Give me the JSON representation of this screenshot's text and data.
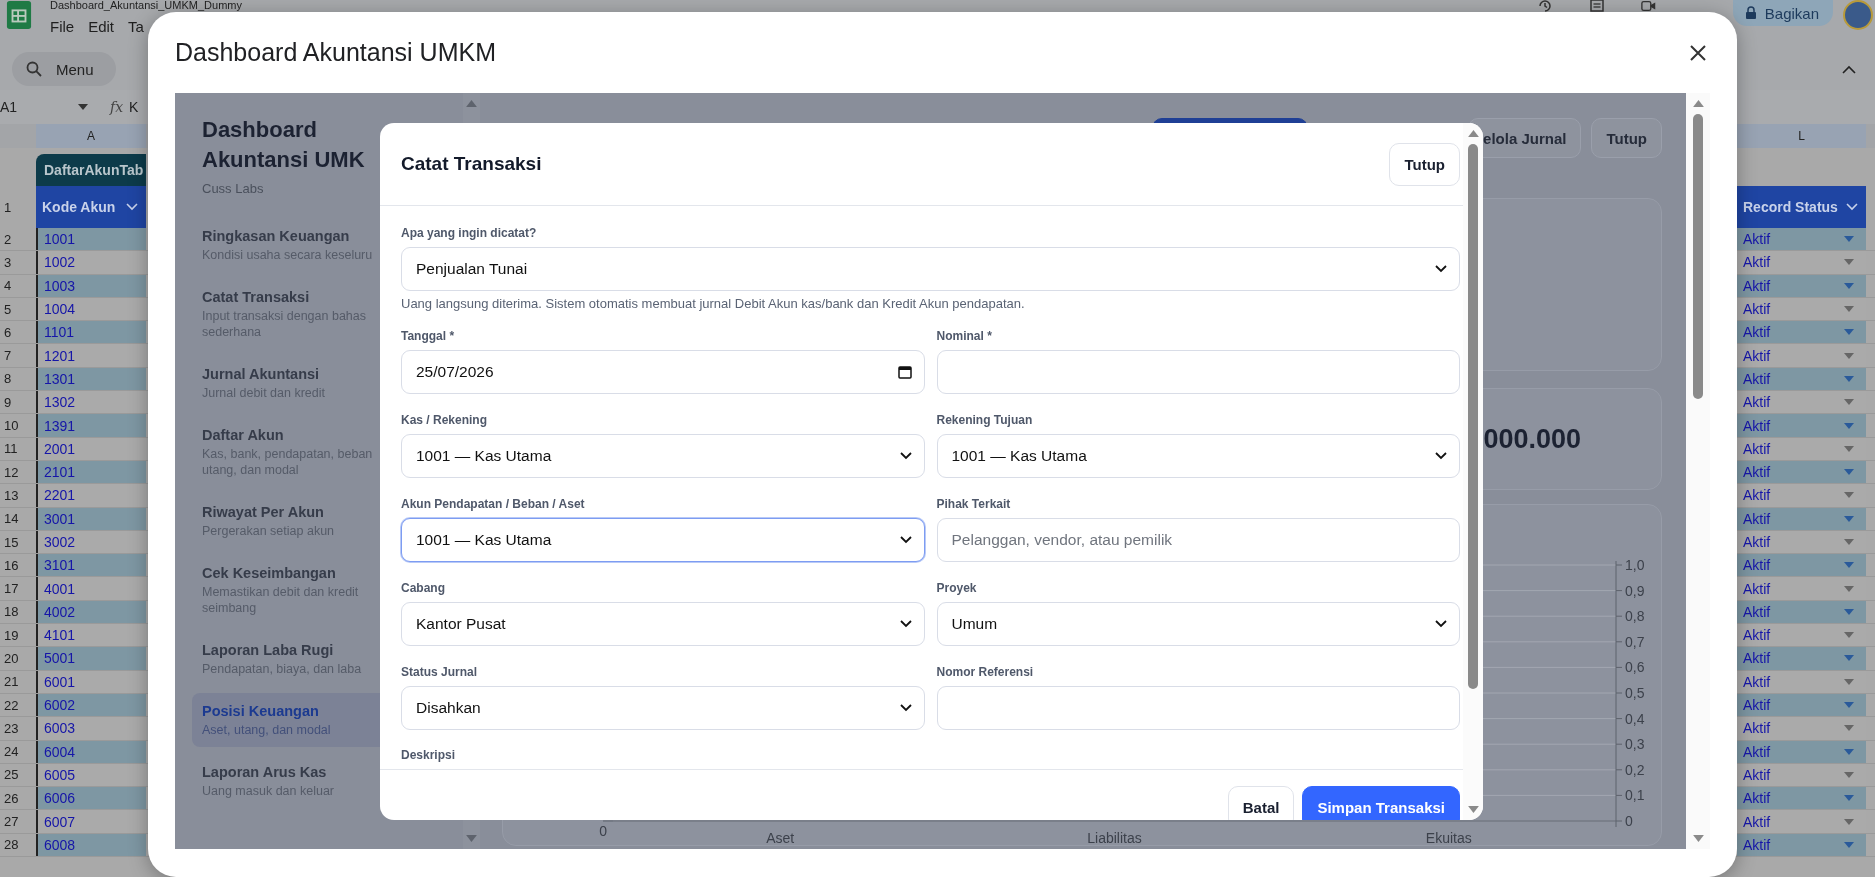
{
  "spreadsheet": {
    "file_title": "Dashboard_Akuntansi_UMKM_Dummy",
    "menus": [
      "File",
      "Edit",
      "Ta"
    ],
    "share_button": "Bagikan",
    "search_label": "Menu",
    "name_box": "A1",
    "function_label": "fx",
    "formula": "K",
    "column_headers": [
      "A",
      "L"
    ],
    "table_tab": "DaftarAkunTab",
    "header_row_number": "1",
    "left_header": "Kode Akun",
    "right_header": "Record Status",
    "rows": [
      {
        "number": "2",
        "code": "1001",
        "status": "Aktif"
      },
      {
        "number": "3",
        "code": "1002",
        "status": "Aktif"
      },
      {
        "number": "4",
        "code": "1003",
        "status": "Aktif"
      },
      {
        "number": "5",
        "code": "1004",
        "status": "Aktif"
      },
      {
        "number": "6",
        "code": "1101",
        "status": "Aktif"
      },
      {
        "number": "7",
        "code": "1201",
        "status": "Aktif"
      },
      {
        "number": "8",
        "code": "1301",
        "status": "Aktif"
      },
      {
        "number": "9",
        "code": "1302",
        "status": "Aktif"
      },
      {
        "number": "10",
        "code": "1391",
        "status": "Aktif"
      },
      {
        "number": "11",
        "code": "2001",
        "status": "Aktif"
      },
      {
        "number": "12",
        "code": "2101",
        "status": "Aktif"
      },
      {
        "number": "13",
        "code": "2201",
        "status": "Aktif"
      },
      {
        "number": "14",
        "code": "3001",
        "status": "Aktif"
      },
      {
        "number": "15",
        "code": "3002",
        "status": "Aktif"
      },
      {
        "number": "16",
        "code": "3101",
        "status": "Aktif"
      },
      {
        "number": "17",
        "code": "4001",
        "status": "Aktif"
      },
      {
        "number": "18",
        "code": "4002",
        "status": "Aktif"
      },
      {
        "number": "19",
        "code": "4101",
        "status": "Aktif"
      },
      {
        "number": "20",
        "code": "5001",
        "status": "Aktif"
      },
      {
        "number": "21",
        "code": "6001",
        "status": "Aktif"
      },
      {
        "number": "22",
        "code": "6002",
        "status": "Aktif"
      },
      {
        "number": "23",
        "code": "6003",
        "status": "Aktif"
      },
      {
        "number": "24",
        "code": "6004",
        "status": "Aktif"
      },
      {
        "number": "25",
        "code": "6005",
        "status": "Aktif"
      },
      {
        "number": "26",
        "code": "6006",
        "status": "Aktif"
      },
      {
        "number": "27",
        "code": "6007",
        "status": "Aktif"
      },
      {
        "number": "28",
        "code": "6008",
        "status": "Aktif"
      }
    ]
  },
  "dialog": {
    "title": "Dashboard Akuntansi UMKM"
  },
  "app": {
    "brand": "Dashboard Akuntansi UMK",
    "company": "Cuss Labs",
    "nav": [
      {
        "title": "Ringkasan Keuangan",
        "description": [
          "Kondisi usaha secara keseluru"
        ],
        "selected": false
      },
      {
        "title": "Catat Transaksi",
        "description": [
          "Input transaksi dengan bahas",
          "sederhana"
        ],
        "selected": false
      },
      {
        "title": "Jurnal Akuntansi",
        "description": [
          "Jurnal debit dan kredit"
        ],
        "selected": false
      },
      {
        "title": "Daftar Akun",
        "description": [
          "Kas, bank, pendapatan, beban",
          "utang, dan modal"
        ],
        "selected": false
      },
      {
        "title": "Riwayat Per Akun",
        "description": [
          "Pergerakan setiap akun"
        ],
        "selected": false
      },
      {
        "title": "Cek Keseimbangan",
        "description": [
          "Memastikan debit dan kredit",
          "seimbang"
        ],
        "selected": false
      },
      {
        "title": "Laporan Laba Rugi",
        "description": [
          "Pendapatan, biaya, dan laba"
        ],
        "selected": false
      },
      {
        "title": "Posisi Keuangan",
        "description": [
          "Aset, utang, dan modal"
        ],
        "selected": true
      },
      {
        "title": "Laporan Arus Kas",
        "description": [
          "Uang masuk dan keluar"
        ],
        "selected": false
      }
    ],
    "header_buttons": [
      {
        "kind": "primary"
      },
      {
        "kind": "outline",
        "label": "elola Jurnal"
      },
      {
        "kind": "outline",
        "label": "Tutup"
      }
    ],
    "summary_value": "000.000",
    "chart": {
      "left_axis_tick": "0",
      "chart_data": {
        "type": "bar",
        "categories": [
          "Aset",
          "Liabilitas",
          "Ekuitas"
        ],
        "series": [
          {
            "values": [
              null,
              null,
              null
            ]
          }
        ],
        "grid": true,
        "ylim": [
          0,
          1
        ],
        "yticks": [
          {
            "value": 0,
            "label": "0"
          },
          {
            "value": 0.1,
            "label": "0,1"
          },
          {
            "value": 0.2,
            "label": "0,2"
          },
          {
            "value": 0.3,
            "label": "0,3"
          },
          {
            "value": 0.4,
            "label": "0,4"
          },
          {
            "value": 0.5,
            "label": "0,5"
          },
          {
            "value": 0.6,
            "label": "0,6"
          },
          {
            "value": 0.7,
            "label": "0,7"
          },
          {
            "value": 0.8,
            "label": "0,8"
          },
          {
            "value": 0.9,
            "label": "0,9"
          },
          {
            "value": 1,
            "label": "1,0"
          }
        ]
      }
    }
  },
  "modal": {
    "title": "Catat Transaksi",
    "close_button": "Tutup",
    "type_field": {
      "label": "Apa yang ingin dicatat?",
      "value": "Penjualan Tunai",
      "help": "Uang langsung diterima. Sistem otomatis membuat jurnal Debit Akun kas/bank dan Kredit Akun pendapatan."
    },
    "fields": [
      {
        "label": "Tanggal *",
        "kind": "date",
        "value": "25/07/2026",
        "focused": false
      },
      {
        "label": "Nominal *",
        "kind": "text",
        "focused": false
      },
      {
        "label": "Kas / Rekening",
        "kind": "select",
        "value": "1001 — Kas Utama",
        "focused": false
      },
      {
        "label": "Rekening Tujuan",
        "kind": "select",
        "value": "1001 — Kas Utama",
        "focused": false
      },
      {
        "label": "Akun Pendapatan / Beban / Aset",
        "kind": "select",
        "value": "1001 — Kas Utama",
        "focused": true
      },
      {
        "label": "Pihak Terkait",
        "kind": "text",
        "placeholder": "Pelanggan, vendor, atau pemilik",
        "focused": false
      },
      {
        "label": "Cabang",
        "kind": "select",
        "value": "Kantor Pusat",
        "focused": false
      },
      {
        "label": "Proyek",
        "kind": "select",
        "value": "Umum",
        "focused": false
      },
      {
        "label": "Status Jurnal",
        "kind": "select",
        "value": "Disahkan",
        "focused": false
      },
      {
        "label": "Nomor Referensi",
        "kind": "text",
        "focused": false
      }
    ],
    "next_label": "Deskripsi",
    "buttons": [
      {
        "label": "Batal",
        "kind": "secondary"
      },
      {
        "label": "Simpan Transaksi",
        "kind": "primary"
      }
    ]
  }
}
